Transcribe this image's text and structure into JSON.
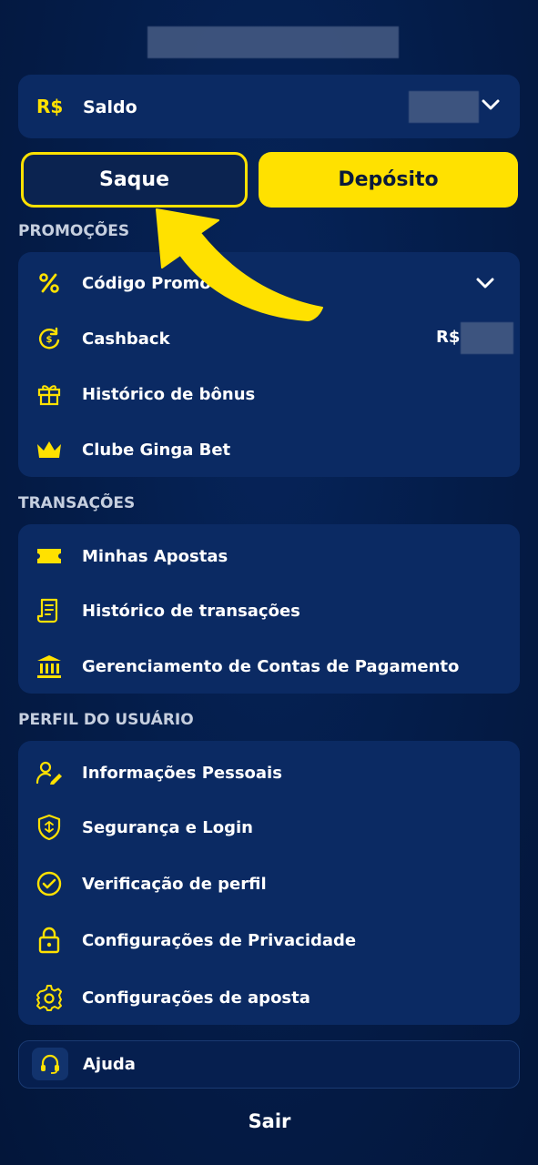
{
  "header": {
    "username_blurred": ""
  },
  "balance": {
    "currency": "R$",
    "label": "Saldo"
  },
  "actions": {
    "withdraw_label": "Saque",
    "deposit_label": "Depósito"
  },
  "promotions": {
    "title": "PROMOÇÕES",
    "items": [
      {
        "label": "Código Promo",
        "icon": "percent-icon"
      },
      {
        "label": "Cashback",
        "icon": "cashback-icon",
        "value_prefix": "R$"
      },
      {
        "label": "Histórico de bônus",
        "icon": "gift-icon"
      },
      {
        "label": "Clube Ginga Bet",
        "icon": "crown-icon"
      }
    ]
  },
  "transactions": {
    "title": "TRANSAÇÕES",
    "items": [
      {
        "label": "Minhas Apostas",
        "icon": "ticket-icon"
      },
      {
        "label": "Histórico de transações",
        "icon": "receipt-icon"
      },
      {
        "label": "Gerenciamento de Contas de Pagamento",
        "icon": "bank-icon"
      }
    ]
  },
  "profile": {
    "title": "PERFIL DO USUÁRIO",
    "items": [
      {
        "label": "Informações Pessoais",
        "icon": "user-edit-icon"
      },
      {
        "label": "Segurança e Login",
        "icon": "shield-icon"
      },
      {
        "label": "Verificação de perfil",
        "icon": "check-circle-icon"
      },
      {
        "label": "Configurações de Privacidade",
        "icon": "lock-icon"
      },
      {
        "label": "Configurações de aposta",
        "icon": "gear-icon"
      }
    ]
  },
  "help": {
    "label": "Ajuda"
  },
  "logout": {
    "label": "Sair"
  },
  "colors": {
    "accent": "#ffe100",
    "card": "#0b2a63",
    "background": "#041c48"
  }
}
